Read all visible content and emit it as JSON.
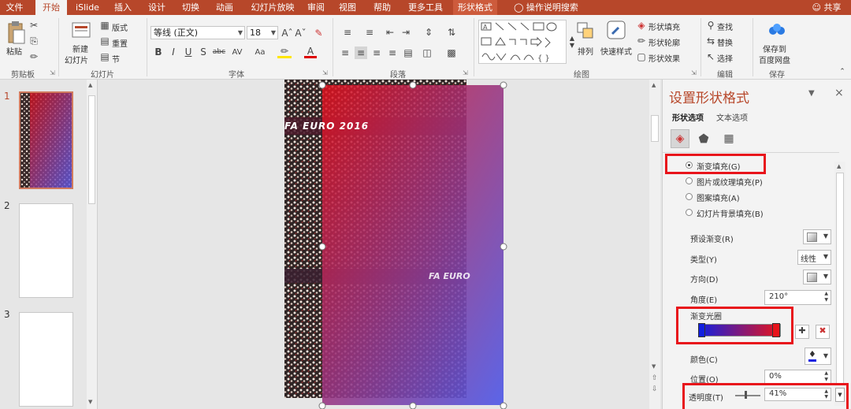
{
  "tabs": [
    "文件",
    "开始",
    "iSlide",
    "插入",
    "设计",
    "切换",
    "动画",
    "幻灯片放映",
    "审阅",
    "视图",
    "帮助",
    "更多工具",
    "形状格式"
  ],
  "tell_me": "操作说明搜索",
  "share": "共享",
  "ribbon": {
    "paste": "粘贴",
    "new_slide_l1": "新建",
    "new_slide_l2": "幻灯片",
    "layout": "版式",
    "reset": "重置",
    "section": "节",
    "font_name": "等线 (正文)",
    "font_size": "18",
    "shape_fill": "形状填充",
    "shape_outline": "形状轮廓",
    "shape_effect": "形状效果",
    "arrange": "排列",
    "quick_styles": "快速样式",
    "find": "查找",
    "replace": "替换",
    "select": "选择",
    "save_l1": "保存到",
    "save_l2": "百度网盘",
    "groups": {
      "clipboard": "剪贴板",
      "slides": "幻灯片",
      "font": "字体",
      "paragraph": "段落",
      "drawing": "绘图",
      "editing": "编辑",
      "save": "保存"
    }
  },
  "slide_numbers": [
    "1",
    "2",
    "3"
  ],
  "photo_text": [
    "FA EURO 2016",
    "FA EURO"
  ],
  "pane": {
    "title": "设置形状格式",
    "tab_shape": "形状选项",
    "tab_text": "文本选项",
    "fill_options": [
      "渐变填充(G)",
      "图片或纹理填充(P)",
      "图案填充(A)",
      "幻灯片背景填充(B)"
    ],
    "preset_label": "预设渐变(R)",
    "type_label": "类型(Y)",
    "type_value": "线性",
    "direction_label": "方向(D)",
    "angle_label": "角度(E)",
    "angle_value": "210°",
    "stops_label": "渐变光圈",
    "color_label": "颜色(C)",
    "position_label": "位置(O)",
    "position_value": "0%",
    "transparency_label": "透明度(T)",
    "transparency_value": "41%"
  },
  "colors": {
    "accent": "#b7472a",
    "highlight": "#e8141b",
    "gradient_start": "#e8141b",
    "gradient_end": "#5a5ae6"
  }
}
